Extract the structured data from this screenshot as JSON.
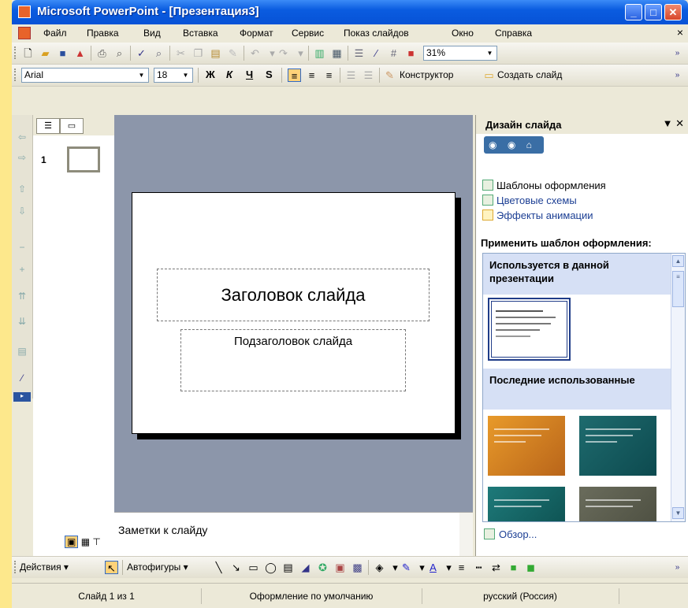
{
  "window": {
    "title": "Microsoft PowerPoint - [Презентация3]"
  },
  "menubar": {
    "items": [
      "Файл",
      "Правка",
      "Вид",
      "Вставка",
      "Формат",
      "Сервис",
      "Показ слайдов",
      "Окно",
      "Справка"
    ],
    "close": "×"
  },
  "standard_toolbar": {
    "zoom": "31%"
  },
  "format_toolbar": {
    "font": "Arial",
    "size": "18",
    "bold": "Ж",
    "italic": "К",
    "underline": "Ч",
    "shadow": "S",
    "designer": "Конструктор",
    "new_slide": "Создать слайд"
  },
  "slide_pane": {
    "slide_number": "1"
  },
  "slide": {
    "title": "Заголовок слайда",
    "subtitle": "Подзаголовок слайда"
  },
  "notes": {
    "placeholder": "Заметки к слайду"
  },
  "task_pane": {
    "title": "Дизайн слайда",
    "links": [
      "Шаблоны оформления",
      "Цветовые схемы",
      "Эффекты анимации"
    ],
    "apply_label": "Применить шаблон оформления:",
    "section_current": "Используется в данной презентации",
    "section_recent": "Последние использованные",
    "browse": "Обзор..."
  },
  "draw_toolbar": {
    "actions": "Действия",
    "autoshapes": "Автофигуры"
  },
  "statusbar": {
    "slide": "Слайд 1 из 1",
    "design": "Оформление по умолчанию",
    "language": "русский (Россия)"
  },
  "colors": {
    "titlebar": "#0a5ce0",
    "accent": "#316ac5",
    "template_orange": "#d8861c",
    "template_teal": "#1e6b6e",
    "template_gray": "#5e6050"
  }
}
